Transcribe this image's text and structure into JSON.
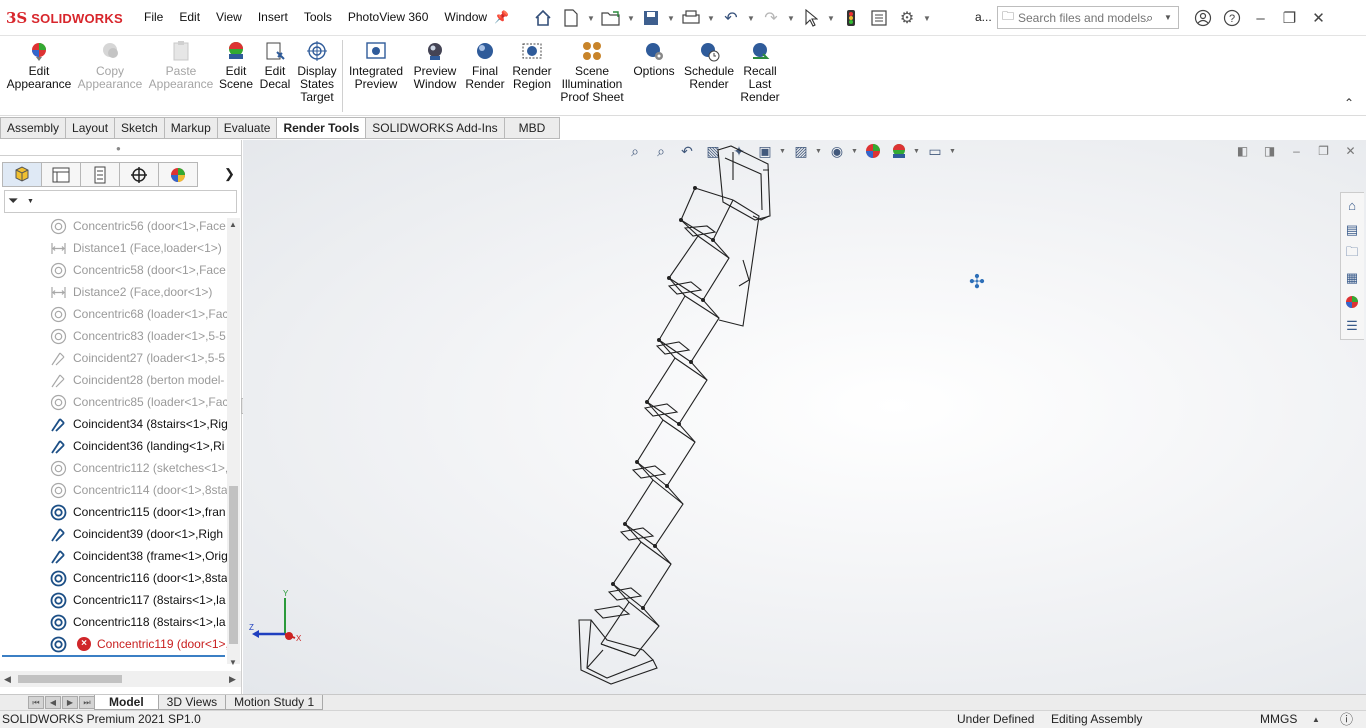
{
  "app": {
    "logo_mark": "3S",
    "logo_text": "SOLIDWORKS",
    "menu": [
      "File",
      "Edit",
      "View",
      "Insert",
      "Tools",
      "PhotoView 360",
      "Window"
    ],
    "user_label": "a...",
    "search_placeholder": "Search files and models"
  },
  "ribbon": {
    "buttons": [
      {
        "id": "edit-appearance",
        "label": "Edit\nAppearance",
        "disabled": false,
        "icon": "appearance-ball-icon"
      },
      {
        "id": "copy-appearance",
        "label": "Copy\nAppearance",
        "disabled": true,
        "icon": "copy-appearance-icon"
      },
      {
        "id": "paste-appearance",
        "label": "Paste\nAppearance",
        "disabled": true,
        "icon": "paste-appearance-icon"
      },
      {
        "id": "edit-scene",
        "label": "Edit\nScene",
        "disabled": false,
        "icon": "scene-icon"
      },
      {
        "id": "edit-decal",
        "label": "Edit\nDecal",
        "disabled": false,
        "icon": "decal-icon"
      },
      {
        "id": "display-states-target",
        "label": "Display\nStates\nTarget",
        "disabled": false,
        "icon": "target-icon"
      },
      {
        "id": "integrated-preview",
        "label": "Integrated\nPreview",
        "disabled": false,
        "icon": "integrated-preview-icon"
      },
      {
        "id": "preview-window",
        "label": "Preview\nWindow",
        "disabled": false,
        "icon": "preview-window-icon"
      },
      {
        "id": "final-render",
        "label": "Final\nRender",
        "disabled": false,
        "icon": "render-sphere-icon"
      },
      {
        "id": "render-region",
        "label": "Render\nRegion",
        "disabled": false,
        "icon": "render-region-icon"
      },
      {
        "id": "scene-illumination-proof-sheet",
        "label": "Scene\nIllumination\nProof Sheet",
        "disabled": false,
        "icon": "proof-sheet-icon"
      },
      {
        "id": "options",
        "label": "Options",
        "disabled": false,
        "icon": "options-gear-icon"
      },
      {
        "id": "schedule-render",
        "label": "Schedule\nRender",
        "disabled": false,
        "icon": "schedule-render-icon"
      },
      {
        "id": "recall-last-render",
        "label": "Recall\nLast\nRender",
        "disabled": false,
        "icon": "recall-render-icon"
      }
    ]
  },
  "tabs": [
    "Assembly",
    "Layout",
    "Sketch",
    "Markup",
    "Evaluate",
    "Render Tools",
    "SOLIDWORKS Add-Ins",
    "MBD"
  ],
  "active_tab": "Render Tools",
  "feature_tree": {
    "mates": [
      {
        "label": "Concentric56 (door<1>,Face",
        "type": "concentric",
        "state": "suppressed"
      },
      {
        "label": "Distance1 (Face,loader<1>)",
        "type": "distance",
        "state": "suppressed"
      },
      {
        "label": "Concentric58 (door<1>,Face",
        "type": "concentric",
        "state": "suppressed"
      },
      {
        "label": "Distance2 (Face,door<1>)",
        "type": "distance",
        "state": "suppressed"
      },
      {
        "label": "Concentric68 (loader<1>,Fac",
        "type": "concentric",
        "state": "suppressed"
      },
      {
        "label": "Concentric83 (loader<1>,5-5",
        "type": "concentric",
        "state": "suppressed"
      },
      {
        "label": "Coincident27 (loader<1>,5-5",
        "type": "coincident",
        "state": "suppressed"
      },
      {
        "label": "Coincident28 (berton model-",
        "type": "coincident",
        "state": "suppressed"
      },
      {
        "label": "Concentric85 (loader<1>,Fac",
        "type": "concentric",
        "state": "suppressed"
      },
      {
        "label": "Coincident34 (8stairs<1>,Rig",
        "type": "coincident",
        "state": "active"
      },
      {
        "label": "Coincident36 (landing<1>,Ri",
        "type": "coincident",
        "state": "active"
      },
      {
        "label": "Concentric112 (sketches<1>,",
        "type": "concentric",
        "state": "suppressed"
      },
      {
        "label": "Concentric114 (door<1>,8sta",
        "type": "concentric",
        "state": "suppressed"
      },
      {
        "label": "Concentric115 (door<1>,fran",
        "type": "concentric",
        "state": "active"
      },
      {
        "label": "Coincident39 (door<1>,Righ",
        "type": "coincident",
        "state": "active"
      },
      {
        "label": "Coincident38 (frame<1>,Orig",
        "type": "coincident",
        "state": "active"
      },
      {
        "label": "Concentric116 (door<1>,8sta",
        "type": "concentric",
        "state": "active"
      },
      {
        "label": "Concentric117 (8stairs<1>,la",
        "type": "concentric",
        "state": "active"
      },
      {
        "label": "Concentric118 (8stairs<1>,la",
        "type": "concentric",
        "state": "active"
      },
      {
        "label": "Concentric119 (door<1>,",
        "type": "concentric",
        "state": "error"
      }
    ]
  },
  "triad": {
    "x": "X",
    "y": "Y",
    "z": "Z"
  },
  "bottom_tabs": [
    "Model",
    "3D Views",
    "Motion Study 1"
  ],
  "active_bottom_tab": "Model",
  "status": {
    "app_version": "SOLIDWORKS Premium 2021 SP1.0",
    "definition": "Under Defined",
    "mode": "Editing Assembly",
    "units": "MMGS"
  },
  "colors": {
    "brand_red": "#d8262c",
    "suppressed_text": "#9a9a9a",
    "error_red": "#c81e1e",
    "selection_blue": "#3b7fc4"
  }
}
